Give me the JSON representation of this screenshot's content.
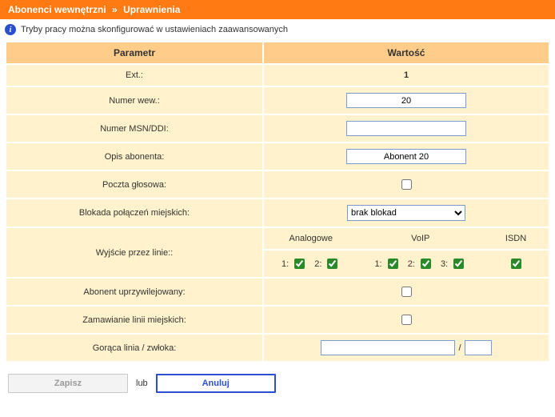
{
  "header": {
    "crumb1": "Abonenci wewnętrzni",
    "sep": "»",
    "crumb2": "Uprawnienia"
  },
  "info": {
    "text": "Tryby pracy można skonfigurować w ustawieniach zaawansowanych"
  },
  "table": {
    "head_param": "Parametr",
    "head_value": "Wartość",
    "ext_label": "Ext.:",
    "ext_value": "1",
    "numwew_label": "Numer wew.:",
    "numwew_value": "20",
    "msn_label": "Numer MSN/DDI:",
    "msn_value": "",
    "opis_label": "Opis abonenta:",
    "opis_value": "Abonent 20",
    "poczta_label": "Poczta głosowa:",
    "blokada_label": "Blokada połączeń miejskich:",
    "blokada_value": "brak blokad",
    "wyjscie_label": "Wyjście przez linie::",
    "col_analog": "Analogowe",
    "col_voip": "VoIP",
    "col_isdn": "ISDN",
    "lbl_1": "1:",
    "lbl_2": "2:",
    "lbl_3": "3:",
    "uprzy_label": "Abonent uprzywilejowany:",
    "zamaw_label": "Zamawianie linii miejskich:",
    "goraca_label": "Gorąca linia / zwłoka:",
    "goraca_num": "",
    "goraca_sep": "/",
    "goraca_delay": ""
  },
  "buttons": {
    "save": "Zapisz",
    "or": "lub",
    "cancel": "Anuluj"
  }
}
